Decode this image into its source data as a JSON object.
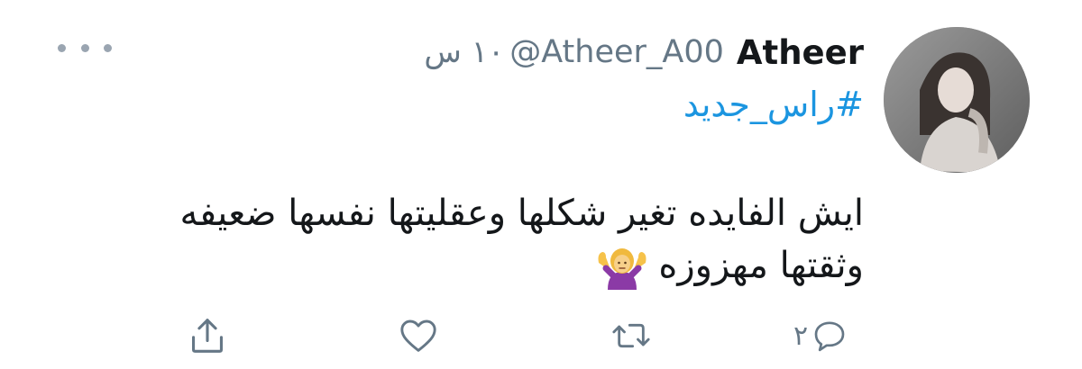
{
  "tweet": {
    "author": {
      "name": "Atheer",
      "handle": "@Atheer_A00",
      "avatar_icon": "user-avatar-photo"
    },
    "time": "١٠ س",
    "hashtag": "#راس_جديد",
    "body": {
      "line1": "ايش الفايده تغير شكلها وعقليتها نفسها ضعيفه",
      "line2": "وثقتها مهزوزه",
      "emoji_icon": "person-shrugging-emoji"
    },
    "actions": {
      "reply_count": "٢",
      "reply_icon": "reply-icon",
      "retweet_icon": "retweet-icon",
      "like_icon": "heart-icon",
      "share_icon": "share-icon"
    },
    "more_icon": "more-options-icon"
  },
  "colors": {
    "text": "#14171a",
    "muted": "#657786",
    "link": "#1b95e0",
    "icon": "#657786"
  }
}
